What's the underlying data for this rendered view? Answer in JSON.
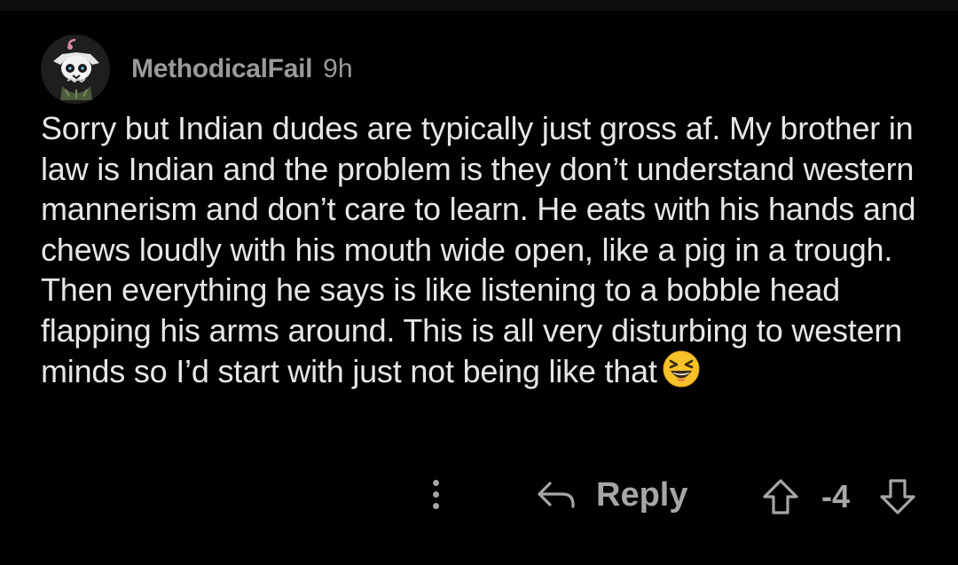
{
  "comment": {
    "author": "MethodicalFail",
    "age": "9h",
    "avatar_icon": "skull-avatar-icon",
    "body": "Sorry but Indian dudes are typically just gross af. My brother in law is Indian and the problem is they don’t understand western mannerism and don’t care to learn. He eats with his hands and chews loudly with his mouth wide open, like a pig in a trough. Then everything he says is like listening to a bobble head flapping his arms around. This is all very disturbing to western minds so I’d start with just not being like that",
    "emoji": "laughing-squinting-face-emoji"
  },
  "actions": {
    "more_icon": "more-vertical-icon",
    "reply_icon": "reply-arrow-icon",
    "reply_label": "Reply",
    "upvote_icon": "arrow-up-icon",
    "score": "-4",
    "downvote_icon": "arrow-down-icon"
  },
  "colors": {
    "background": "#000000",
    "text": "#e6e6e6",
    "muted": "#9a9a9a",
    "icon": "#a6a6a6"
  }
}
